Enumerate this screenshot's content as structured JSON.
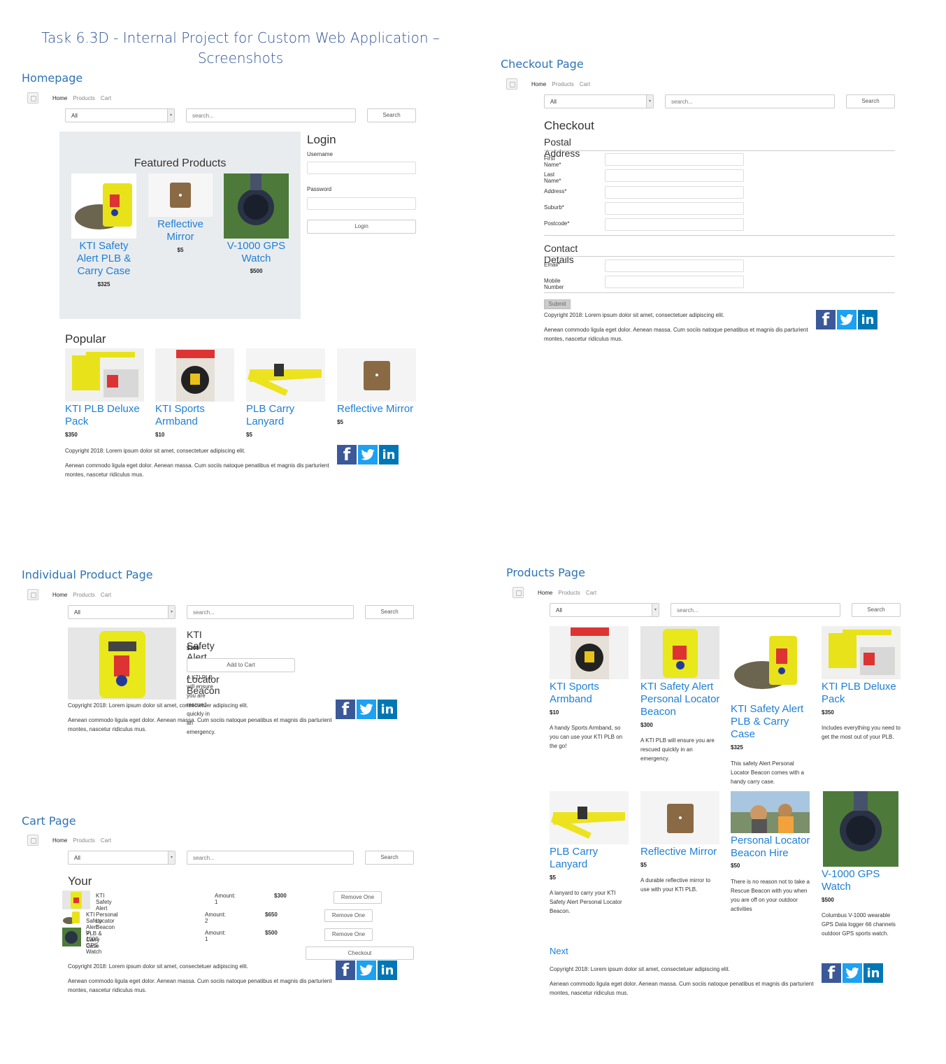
{
  "doc": {
    "title": "Task 6.3D - Internal Project for Custom Web Application – Screenshots",
    "sections": {
      "homepage": "Homepage",
      "checkout": "Checkout Page",
      "individual": "Individual Product Page",
      "products": "Products Page",
      "cart": "Cart Page"
    }
  },
  "nav": {
    "home": "Home",
    "products": "Products",
    "cart": "Cart"
  },
  "searchbar": {
    "category": "All",
    "placeholder": "search...",
    "button": "Search"
  },
  "footer": {
    "copyright": "Copyright 2018: Lorem ipsum dolor sit amet, consectetuer adipiscing elit.",
    "text": "Aenean commodo ligula eget dolor. Aenean massa. Cum sociis natoque penatibus et magnis dis parturient montes, nascetur ridiculus mus.",
    "social": {
      "facebook": "f",
      "twitter": "t",
      "linkedin": "in"
    }
  },
  "homepage": {
    "featured_title": "Featured Products",
    "featured": [
      {
        "name": "KTI Safety Alert PLB & Carry Case",
        "price": "$325"
      },
      {
        "name": "Reflective Mirror",
        "price": "$5"
      },
      {
        "name": "V-1000 GPS Watch",
        "price": "$500"
      }
    ],
    "login": {
      "title": "Login",
      "username": "Username",
      "password": "Password",
      "button": "Login"
    },
    "popular_title": "Popular Products",
    "popular": [
      {
        "name": "KTI PLB Deluxe Pack",
        "price": "$350"
      },
      {
        "name": "KTI Sports Armband",
        "price": "$10"
      },
      {
        "name": "PLB Carry Lanyard",
        "price": "$5"
      },
      {
        "name": "Reflective Mirror",
        "price": "$5"
      }
    ]
  },
  "checkout": {
    "title": "Checkout",
    "postal_title": "Postal Address",
    "postal_fields": [
      "First Name*",
      "Last Name*",
      "Address*",
      "Suburb*",
      "Postcode*"
    ],
    "contact_title": "Contact Details",
    "contact_fields": [
      "Email*",
      "Mobile Number"
    ],
    "submit": "Submit"
  },
  "individual": {
    "name": "KTI Safety Alert Personal Locator Beacon",
    "price": "$300",
    "add_button": "Add to Cart",
    "description": "A KTI PLB will ensure you are rescued quickly in an emergency."
  },
  "cart": {
    "title": "Your Cart",
    "items": [
      {
        "name": "KTI Safety Alert Personal Locator Beacon",
        "amount": "Amount: 1",
        "price": "$300",
        "button": "Remove One"
      },
      {
        "name": "KTI Safety Alert PLB & Carry Case",
        "amount": "Amount: 2",
        "price": "$650",
        "button": "Remove One"
      },
      {
        "name": "V-1000 GPS Watch",
        "amount": "Amount: 1",
        "price": "$500",
        "button": "Remove One"
      }
    ],
    "checkout_button": "Checkout"
  },
  "products": {
    "items": [
      {
        "name": "KTI Sports Armband",
        "price": "$10",
        "desc": "A handy Sports Armband, so you can use your KTI PLB on the go!"
      },
      {
        "name": "KTI Safety Alert Personal Locator Beacon",
        "price": "$300",
        "desc": "A KTI PLB will ensure you are rescued quickly in an emergency."
      },
      {
        "name": "KTI Safety Alert PLB & Carry Case",
        "price": "$325",
        "desc": "This safety Alert Personal Locator Beacon comes with a handy carry case."
      },
      {
        "name": "KTI PLB Deluxe Pack",
        "price": "$350",
        "desc": "Includes everything you need to get the most out of your PLB."
      },
      {
        "name": "PLB Carry Lanyard",
        "price": "$5",
        "desc": "A lanyard to carry your KTI Safety Alert Personal Locator Beacon."
      },
      {
        "name": "Reflective Mirror",
        "price": "$5",
        "desc": "A durable reflective mirror to use with your KTI PLB."
      },
      {
        "name": "Personal Locator Beacon Hire",
        "price": "$50",
        "desc": "There is no reason not to take a Rescue Beacon with you when you are off on your outdoor activities"
      },
      {
        "name": "V-1000 GPS Watch",
        "price": "$500",
        "desc": "Columbus V-1000 wearable GPS Data logger 66 channels outdoor GPS sports watch."
      }
    ],
    "next": "Next"
  }
}
